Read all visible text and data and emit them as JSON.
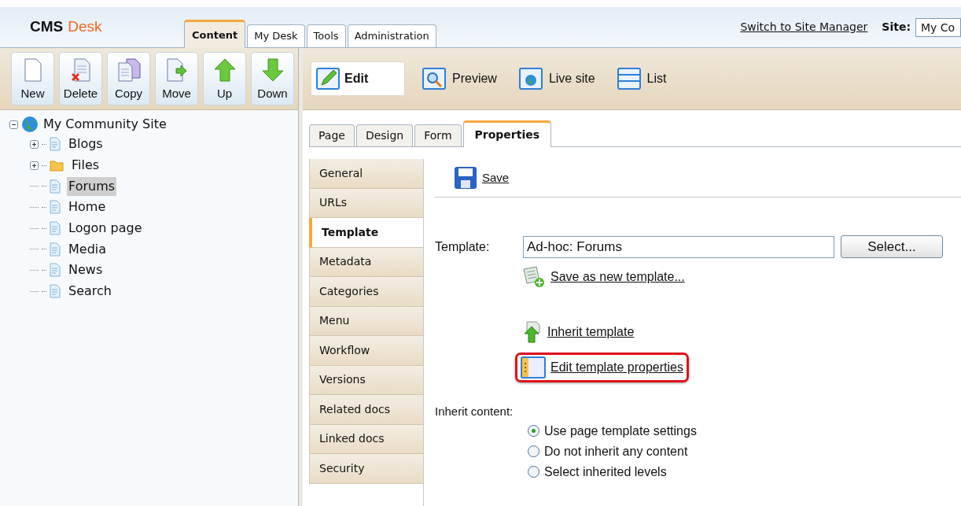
{
  "header": {
    "logo_part_1": "CMS",
    "logo_part_2": "Desk",
    "tabs": [
      {
        "label": "Content",
        "selected": true
      },
      {
        "label": "My Desk",
        "selected": false
      },
      {
        "label": "Tools",
        "selected": false
      },
      {
        "label": "Administration",
        "selected": false
      }
    ],
    "switch_link": "Switch to Site Manager",
    "site_label": "Site:",
    "site_value": "My Co"
  },
  "toolbar": [
    {
      "label": "New",
      "kind": "new"
    },
    {
      "label": "Delete",
      "kind": "delete"
    },
    {
      "label": "Copy",
      "kind": "copy"
    },
    {
      "label": "Move",
      "kind": "move"
    },
    {
      "label": "Up",
      "kind": "up"
    },
    {
      "label": "Down",
      "kind": "down"
    }
  ],
  "view_modes": [
    {
      "label": "Edit",
      "kind": "edit",
      "selected": true
    },
    {
      "label": "Preview",
      "kind": "preview",
      "selected": false
    },
    {
      "label": "Live site",
      "kind": "live",
      "selected": false
    },
    {
      "label": "List",
      "kind": "list",
      "selected": false
    }
  ],
  "tree": {
    "label": "My Community Site",
    "expanded": true,
    "selected": false,
    "children": [
      {
        "label": "Blogs",
        "kind": "page",
        "expandable": true,
        "selected": false
      },
      {
        "label": "Files",
        "kind": "folder",
        "expandable": true,
        "selected": false
      },
      {
        "label": "Forums",
        "kind": "page",
        "expandable": false,
        "selected": true
      },
      {
        "label": "Home",
        "kind": "page",
        "expandable": false,
        "selected": false
      },
      {
        "label": "Logon page",
        "kind": "page",
        "expandable": false,
        "selected": false
      },
      {
        "label": "Media",
        "kind": "page",
        "expandable": false,
        "selected": false
      },
      {
        "label": "News",
        "kind": "page",
        "expandable": false,
        "selected": false
      },
      {
        "label": "Search",
        "kind": "page",
        "expandable": false,
        "selected": false
      }
    ]
  },
  "page_tabs": [
    {
      "label": "Page",
      "selected": false
    },
    {
      "label": "Design",
      "selected": false
    },
    {
      "label": "Form",
      "selected": false
    },
    {
      "label": "Properties",
      "selected": true
    }
  ],
  "side_tabs": [
    {
      "label": "General",
      "selected": false
    },
    {
      "label": "URLs",
      "selected": false
    },
    {
      "label": "Template",
      "selected": true
    },
    {
      "label": "Metadata",
      "selected": false
    },
    {
      "label": "Categories",
      "selected": false
    },
    {
      "label": "Menu",
      "selected": false
    },
    {
      "label": "Workflow",
      "selected": false
    },
    {
      "label": "Versions",
      "selected": false
    },
    {
      "label": "Related docs",
      "selected": false
    },
    {
      "label": "Linked docs",
      "selected": false
    },
    {
      "label": "Security",
      "selected": false
    }
  ],
  "save": "Save",
  "template": {
    "label": "Template:",
    "value": "Ad-hoc: Forums",
    "select_button": "Select..."
  },
  "links": [
    {
      "label": "Save as new template...",
      "kind": "save_new",
      "highlighted": false
    },
    {
      "label": "Inherit template",
      "kind": "inherit",
      "highlighted": false
    },
    {
      "label": "Edit template properties",
      "kind": "edit_props",
      "highlighted": true
    }
  ],
  "inherit_content": {
    "label": "Inherit content:",
    "options": [
      {
        "label": "Use page template settings",
        "selected": true
      },
      {
        "label": "Do not inherit any content",
        "selected": false
      },
      {
        "label": "Select inherited levels",
        "selected": false
      }
    ]
  }
}
